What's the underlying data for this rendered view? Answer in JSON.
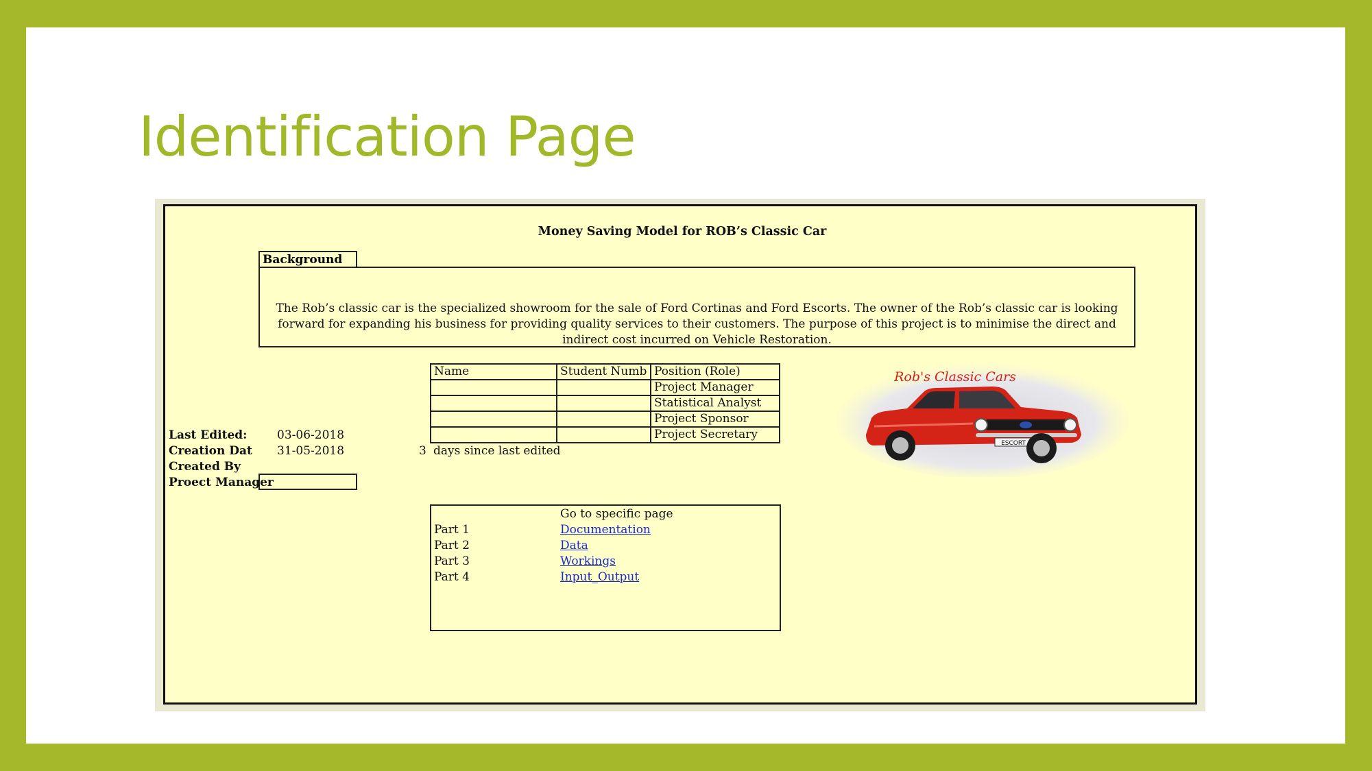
{
  "slide": {
    "title": "Identification Page"
  },
  "sheet": {
    "title": "Money Saving Model for ROB’s Classic Car",
    "background": {
      "label": "Background",
      "text": "The Rob’s classic car is the specialized showroom for the sale of Ford Cortinas and Ford Escorts. The owner of the Rob’s classic car is looking forward for expanding his business for providing quality services to their customers. The purpose of this project is to minimise the direct and indirect cost incurred on Vehicle Restoration."
    },
    "team_table": {
      "headers": [
        "Name",
        "Student Numb",
        "Position (Role)"
      ],
      "rows": [
        [
          "",
          "",
          "Project Manager"
        ],
        [
          "",
          "",
          "Statistical Analyst"
        ],
        [
          "",
          "",
          "Project Sponsor"
        ],
        [
          "",
          "",
          "Project Secretary"
        ]
      ]
    },
    "meta": {
      "last_edited_label": "Last Edited:",
      "last_edited_value": "03-06-2018",
      "creation_label": "Creation Dat",
      "creation_value": "31-05-2018",
      "created_by_label": "Created By",
      "project_manager_label": "Proect Manager",
      "days_count": "3",
      "days_text": "days since last edited"
    },
    "navigation": {
      "heading": "Go to specific page",
      "items": [
        {
          "part": "Part 1",
          "link": "Documentation"
        },
        {
          "part": "Part 2",
          "link": "Data"
        },
        {
          "part": "Part 3",
          "link": "Workings"
        },
        {
          "part": "Part 4",
          "link": "Input_Output"
        }
      ]
    },
    "logo": {
      "text": "Rob's Classic Cars",
      "plate": "ESCORT",
      "icon": "red-classic-car-illustration",
      "colors": {
        "car": "#d42418",
        "logo_text": "#d42418",
        "backdrop": "#e6e6ea"
      }
    }
  },
  "colors": {
    "frame": "#a5b82a",
    "title": "#a2b829",
    "sheet_background": "#ffffc8",
    "link": "#1a2bcc"
  }
}
